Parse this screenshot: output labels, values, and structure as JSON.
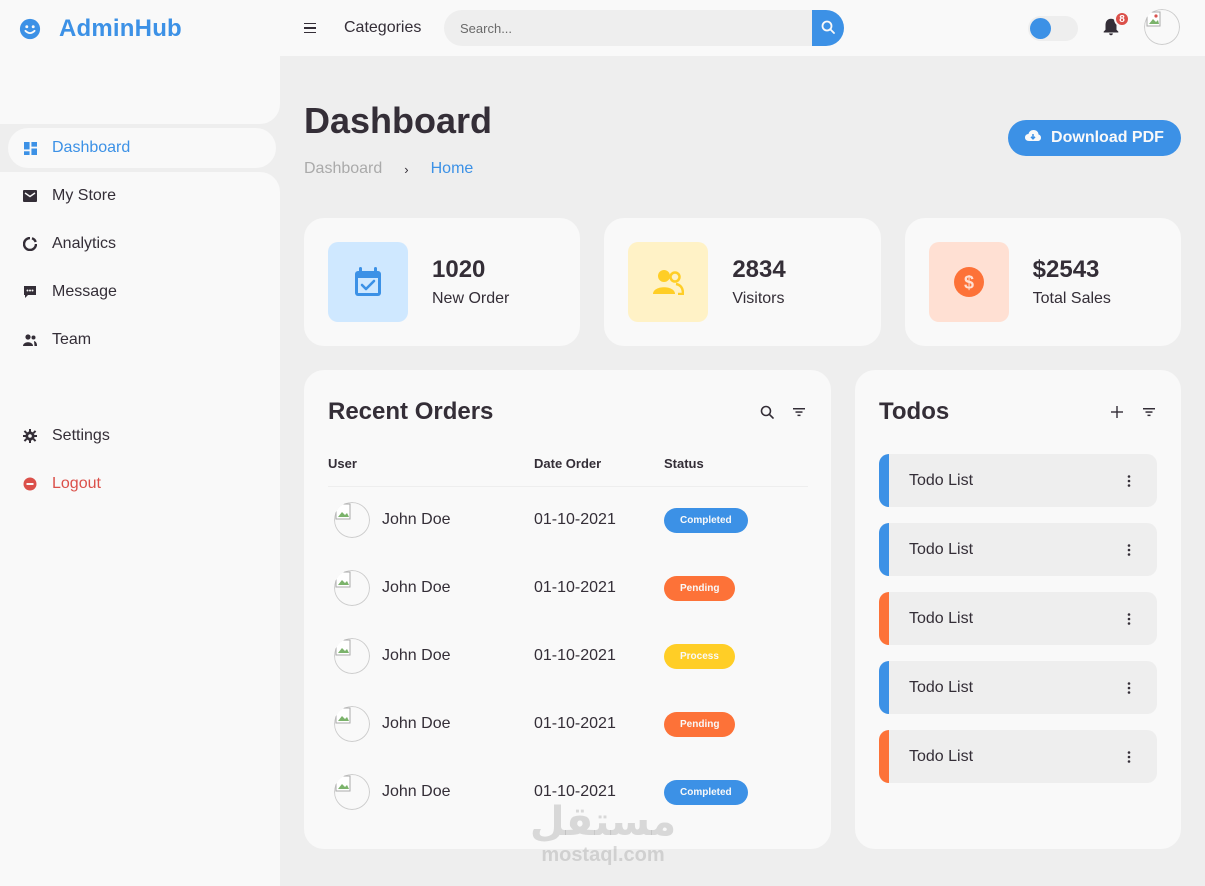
{
  "brand": {
    "name": "AdminHub",
    "icon": "smile-icon"
  },
  "sidebar": {
    "items": [
      {
        "label": "Dashboard",
        "icon": "dashboard-icon",
        "active": true
      },
      {
        "label": "My Store",
        "icon": "store-icon"
      },
      {
        "label": "Analytics",
        "icon": "analytics-icon"
      },
      {
        "label": "Message",
        "icon": "message-icon"
      },
      {
        "label": "Team",
        "icon": "team-icon"
      }
    ],
    "bottom_items": [
      {
        "label": "Settings",
        "icon": "gear-icon"
      },
      {
        "label": "Logout",
        "icon": "logout-icon"
      }
    ]
  },
  "navbar": {
    "categories_label": "Categories",
    "search_placeholder": "Search...",
    "notification_count": "8"
  },
  "page": {
    "title": "Dashboard",
    "breadcrumb": [
      "Dashboard",
      "Home"
    ],
    "download_label": "Download PDF"
  },
  "stats": [
    {
      "value": "1020",
      "label": "New Order",
      "icon": "calendar-check-icon"
    },
    {
      "value": "2834",
      "label": "Visitors",
      "icon": "group-icon"
    },
    {
      "value": "$2543",
      "label": "Total Sales",
      "icon": "dollar-circle-icon"
    }
  ],
  "orders": {
    "title": "Recent Orders",
    "columns": [
      "User",
      "Date Order",
      "Status"
    ],
    "rows": [
      {
        "user": "John Doe",
        "date": "01-10-2021",
        "status": "Completed"
      },
      {
        "user": "John Doe",
        "date": "01-10-2021",
        "status": "Pending"
      },
      {
        "user": "John Doe",
        "date": "01-10-2021",
        "status": "Process"
      },
      {
        "user": "John Doe",
        "date": "01-10-2021",
        "status": "Pending"
      },
      {
        "user": "John Doe",
        "date": "01-10-2021",
        "status": "Completed"
      }
    ]
  },
  "todos": {
    "title": "Todos",
    "items": [
      {
        "label": "Todo List",
        "state": "completed"
      },
      {
        "label": "Todo List",
        "state": "completed"
      },
      {
        "label": "Todo List",
        "state": "not-completed"
      },
      {
        "label": "Todo List",
        "state": "completed"
      },
      {
        "label": "Todo List",
        "state": "not-completed"
      }
    ]
  },
  "watermark": {
    "arabic": "مستقل",
    "latin": "mostaql.com"
  },
  "colors": {
    "blue": "#3c91e6",
    "light_blue": "#cfe8ff",
    "yellow": "#ffce26",
    "light_yellow": "#fff2c6",
    "orange": "#fd7238",
    "light_orange": "#ffe0d3",
    "red": "#db504a",
    "dark": "#342e37"
  }
}
